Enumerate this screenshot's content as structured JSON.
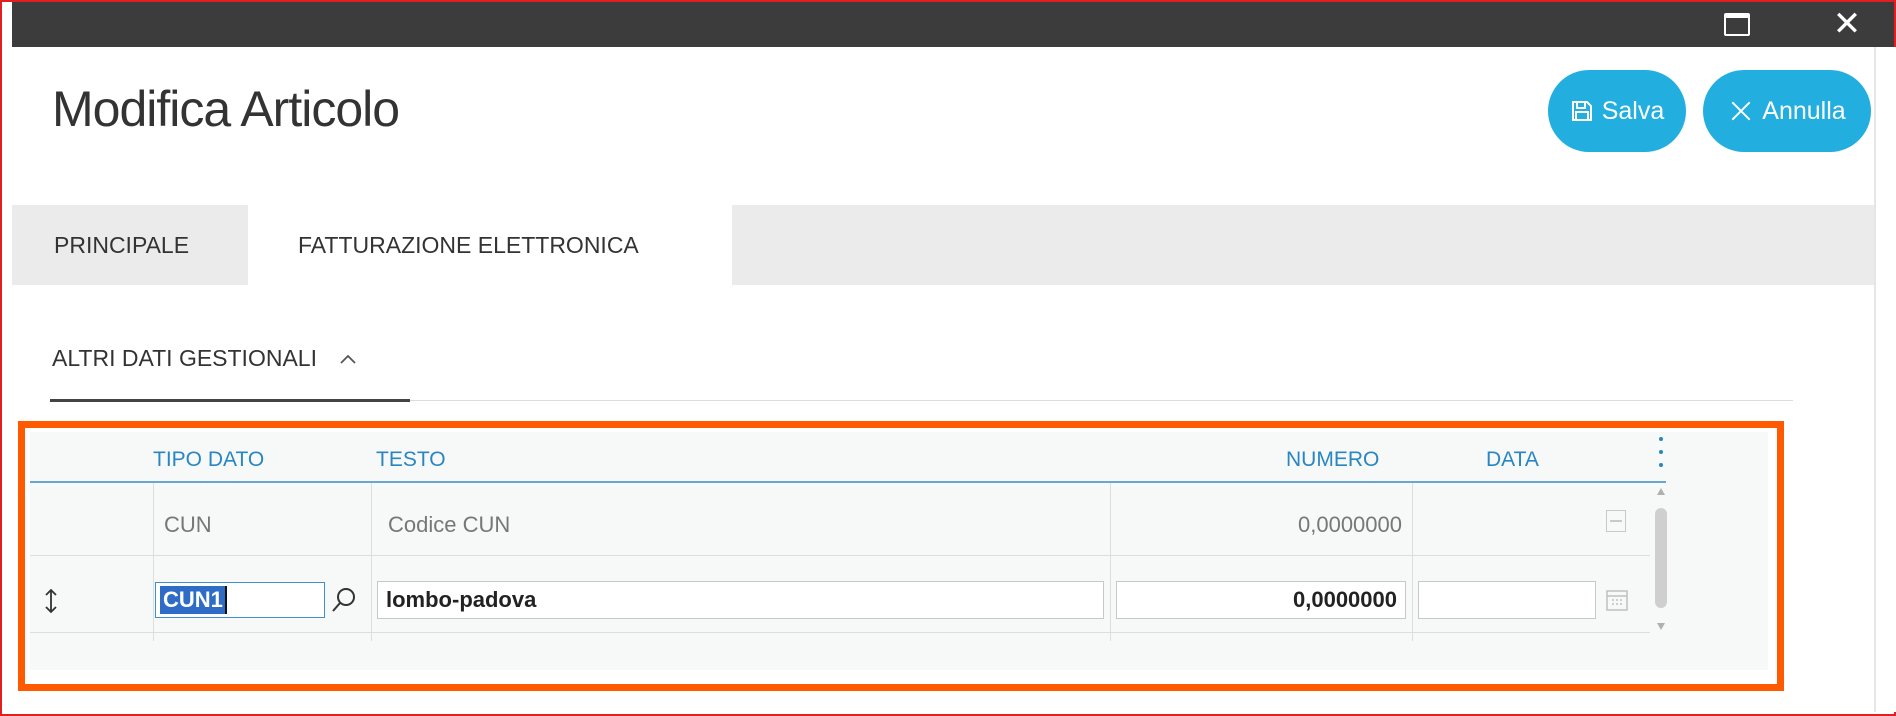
{
  "window": {
    "restore_icon": "restore-window-icon",
    "close_icon": "close-icon",
    "close_glyph": "✕"
  },
  "header": {
    "title": "Modifica Articolo",
    "save_label": "Salva",
    "cancel_label": "Annulla",
    "save_icon": "floppy-disk-icon",
    "cancel_icon": "x-icon",
    "accent_color": "#22afe0"
  },
  "tabs": [
    {
      "label": "PRINCIPALE",
      "active": false
    },
    {
      "label": "FATTURAZIONE ELETTRONICA",
      "active": true
    }
  ],
  "section": {
    "label": "ALTRI DATI GESTIONALI",
    "expanded": true,
    "toggle_icon": "chevron-up-icon"
  },
  "grid": {
    "columns": [
      "TIPO DATO",
      "TESTO",
      "NUMERO",
      "DATA"
    ],
    "header_color": "#2a86c2",
    "highlight_color": "#ff5a00",
    "menu_icon": "kebab-menu-icon",
    "rows": [
      {
        "tipo_dato": "CUN",
        "testo": "Codice CUN",
        "numero": "0,0000000",
        "data": ""
      }
    ],
    "edit_row": {
      "tipo_dato": "CUN1",
      "testo": "lombo-padova",
      "numero": "0,0000000",
      "data": "",
      "move_icon": "up-down-arrow-icon",
      "search_icon": "search-icon",
      "calendar_icon": "calendar-icon"
    }
  }
}
